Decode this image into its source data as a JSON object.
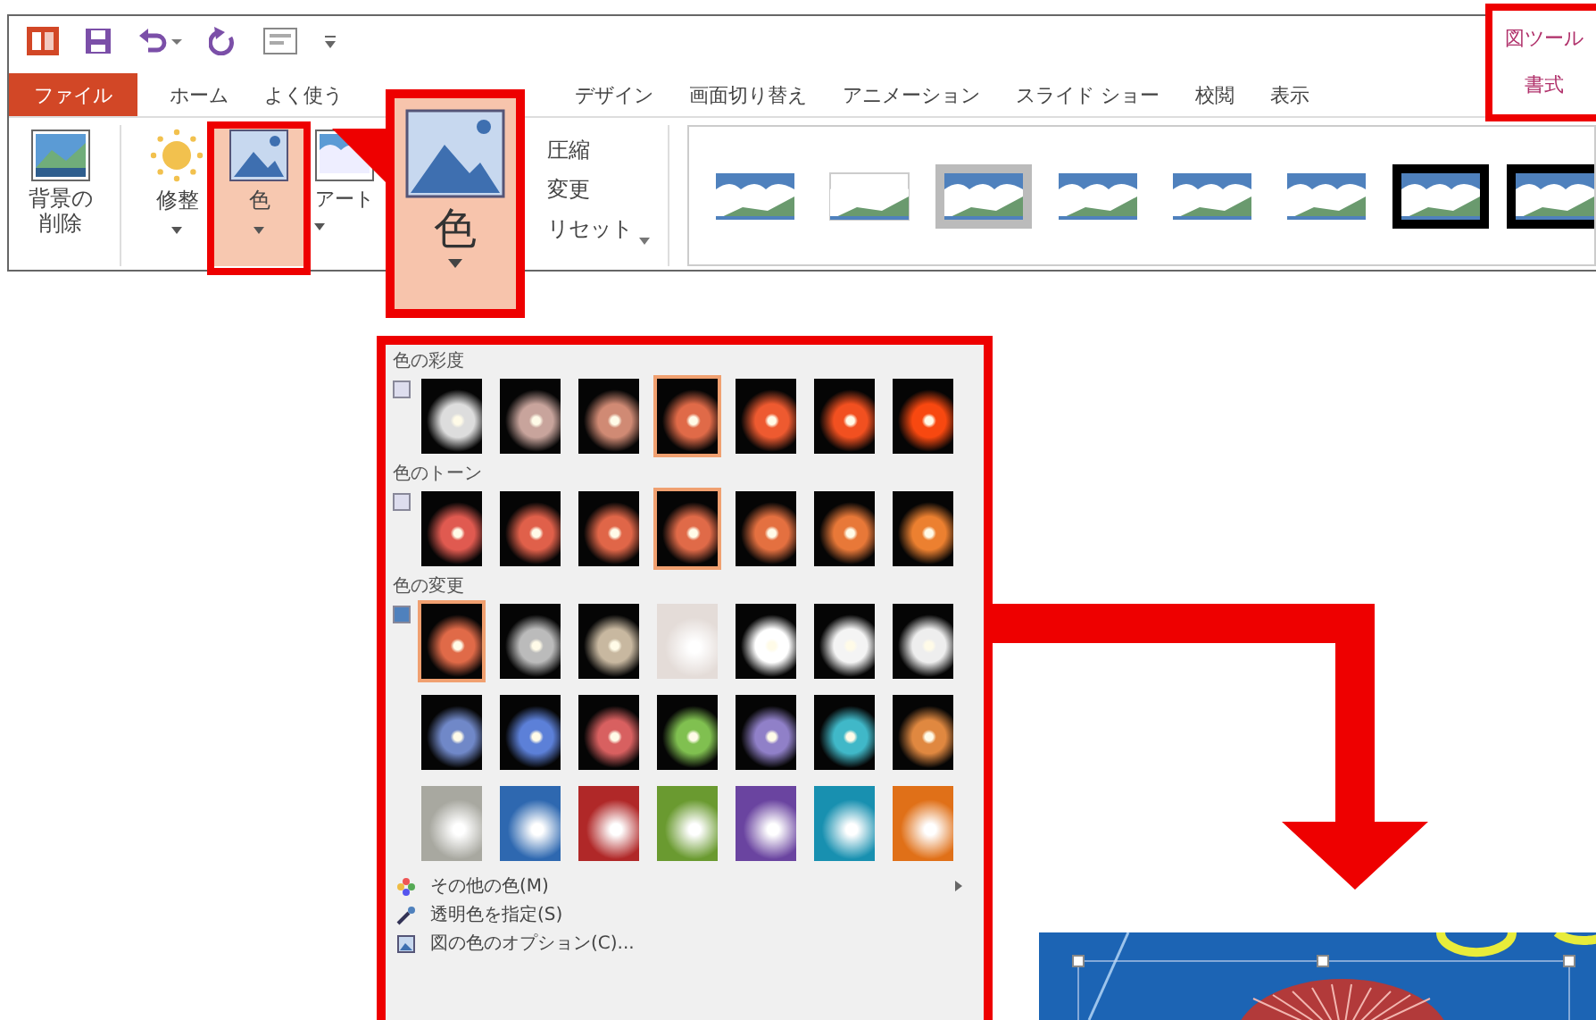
{
  "tabs": [
    {
      "label": "ファイル",
      "kind": "file",
      "selected": false
    },
    {
      "label": "ホーム",
      "kind": "normal",
      "selected": false
    },
    {
      "label": "よく使う",
      "kind": "normal",
      "selected": false
    },
    {
      "label": "デザイン",
      "kind": "normal",
      "selected": false
    },
    {
      "label": "画面切り替え",
      "kind": "normal",
      "selected": false
    },
    {
      "label": "アニメーション",
      "kind": "normal",
      "selected": false
    },
    {
      "label": "スライド ショー",
      "kind": "normal",
      "selected": false
    },
    {
      "label": "校閲",
      "kind": "normal",
      "selected": false
    },
    {
      "label": "表示",
      "kind": "normal",
      "selected": false
    },
    {
      "label": "書式",
      "kind": "contextual",
      "context_label": "図ツール",
      "selected": true
    }
  ],
  "ribbon": {
    "remove_background": "背景の削除",
    "corrections": "修整",
    "color": {
      "label": "色",
      "pressed": true
    },
    "artistic": "アート",
    "small_commands": [
      "圧縮",
      "変更",
      "リセット"
    ]
  },
  "callout": {
    "label": "色"
  },
  "color_menu": {
    "sections": [
      {
        "title": "色の彩度",
        "items": [
          {
            "kind": "dark",
            "color": "#dddddd",
            "selected": false
          },
          {
            "kind": "dark",
            "color": "#c8a49c",
            "selected": false
          },
          {
            "kind": "dark",
            "color": "#d08a74",
            "selected": false
          },
          {
            "kind": "dark",
            "color": "#e06a48",
            "selected": true
          },
          {
            "kind": "dark",
            "color": "#ee5a30",
            "selected": false
          },
          {
            "kind": "dark",
            "color": "#f25020",
            "selected": false
          },
          {
            "kind": "dark",
            "color": "#f84810",
            "selected": false
          }
        ]
      },
      {
        "title": "色のトーン",
        "items": [
          {
            "kind": "dark",
            "color": "#e05a50",
            "selected": false
          },
          {
            "kind": "dark",
            "color": "#e0604a",
            "selected": false
          },
          {
            "kind": "dark",
            "color": "#e06648",
            "selected": false
          },
          {
            "kind": "dark",
            "color": "#e06a48",
            "selected": true
          },
          {
            "kind": "dark",
            "color": "#e47040",
            "selected": false
          },
          {
            "kind": "dark",
            "color": "#e87838",
            "selected": false
          },
          {
            "kind": "dark",
            "color": "#ec8030",
            "selected": false
          }
        ]
      },
      {
        "title": "色の変更",
        "items": [
          {
            "kind": "dark",
            "color": "#e06a48",
            "selected": true
          },
          {
            "kind": "dark",
            "color": "#bbbbbb",
            "selected": false
          },
          {
            "kind": "dark",
            "color": "#c8b8a0",
            "selected": false
          },
          {
            "kind": "fill",
            "color": "#e4dcd8",
            "selected": false
          },
          {
            "kind": "dark",
            "color": "#ffffff",
            "selected": false
          },
          {
            "kind": "dark",
            "color": "#f4f4f4",
            "selected": false
          },
          {
            "kind": "dark",
            "color": "#eeeeee",
            "selected": false
          },
          {
            "kind": "dark",
            "color": "#7088c8",
            "selected": false
          },
          {
            "kind": "dark",
            "color": "#5c80d8",
            "selected": false
          },
          {
            "kind": "dark",
            "color": "#d86060",
            "selected": false
          },
          {
            "kind": "dark",
            "color": "#80c050",
            "selected": false
          },
          {
            "kind": "dark",
            "color": "#9080c8",
            "selected": false
          },
          {
            "kind": "dark",
            "color": "#40b8c8",
            "selected": false
          },
          {
            "kind": "dark",
            "color": "#e08840",
            "selected": false
          },
          {
            "kind": "fill",
            "color": "#a8a8a0",
            "selected": false
          },
          {
            "kind": "fill",
            "color": "#2e68b0",
            "selected": false
          },
          {
            "kind": "fill",
            "color": "#b02828",
            "selected": false
          },
          {
            "kind": "fill",
            "color": "#6a9a30",
            "selected": false
          },
          {
            "kind": "fill",
            "color": "#6a44a0",
            "selected": false
          },
          {
            "kind": "fill",
            "color": "#1890b0",
            "selected": false
          },
          {
            "kind": "fill",
            "color": "#e07018",
            "selected": false
          }
        ]
      }
    ],
    "commands": [
      {
        "label": "その他の色(M)",
        "kind": "palette",
        "submenu": true
      },
      {
        "label": "透明色を指定(S)",
        "kind": "eyedropper",
        "submenu": false
      },
      {
        "label": "図の色のオプション(C)...",
        "kind": "options",
        "submenu": false
      }
    ]
  }
}
